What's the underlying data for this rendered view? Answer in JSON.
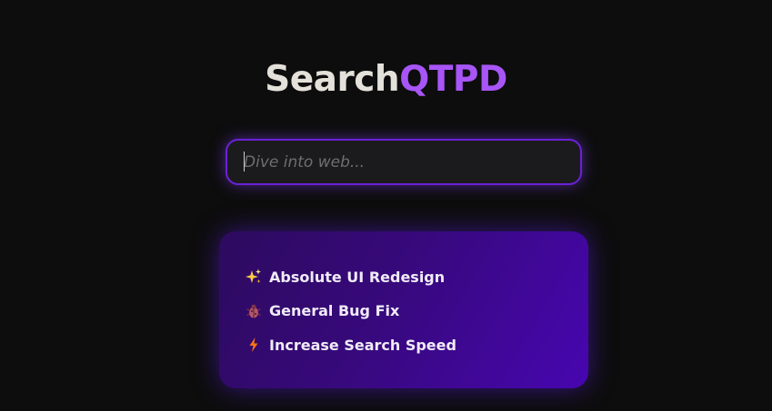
{
  "logo": {
    "main": "Search",
    "accent": "QTPD"
  },
  "search": {
    "placeholder": "Dive into web...",
    "value": ""
  },
  "changelog": {
    "items": [
      {
        "icon": "sparkles-icon",
        "label": "Absolute UI Redesign"
      },
      {
        "icon": "bug-icon",
        "label": "General Bug Fix"
      },
      {
        "icon": "lightning-icon",
        "label": "Increase Search Speed"
      }
    ]
  },
  "colors": {
    "background": "#0d0d0d",
    "accent": "#a855f7",
    "search_border": "#6b21d8",
    "card_start": "#2d0a5e",
    "card_end": "#4706b0"
  }
}
